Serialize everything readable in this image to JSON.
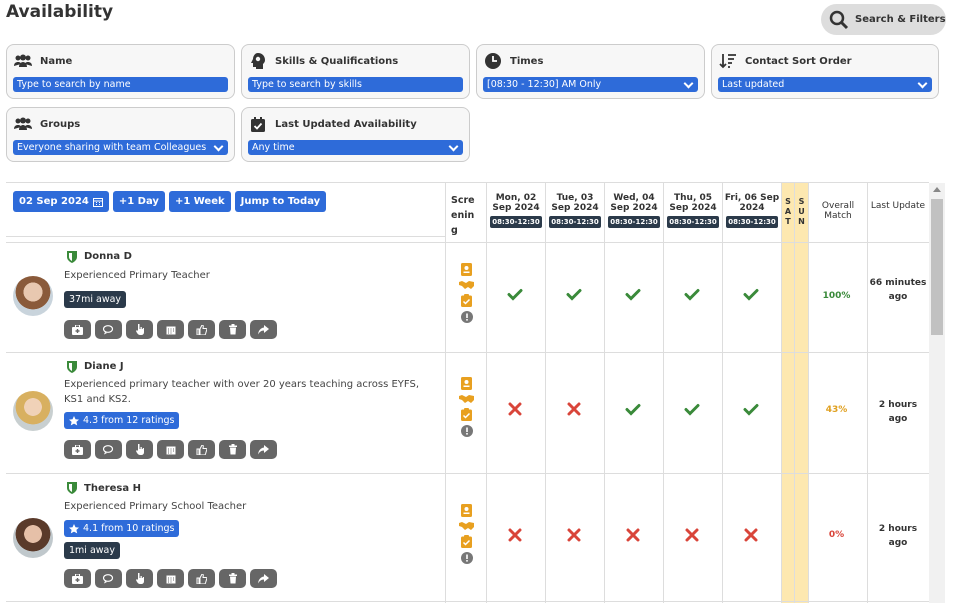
{
  "page_title": "Availability",
  "search_filters_label": "Search & Filters",
  "filters": {
    "name": {
      "label": "Name",
      "placeholder": "Type to search by name"
    },
    "skills": {
      "label": "Skills & Qualifications",
      "placeholder": "Type to search by skills"
    },
    "times": {
      "label": "Times",
      "value": "[08:30 - 12:30] AM Only"
    },
    "sort": {
      "label": "Contact Sort Order",
      "value": "Last updated"
    },
    "groups": {
      "label": "Groups",
      "value": "Everyone sharing with team Colleagues"
    },
    "last_updated": {
      "label": "Last Updated Availability",
      "value": "Any time"
    }
  },
  "toolbar": {
    "date": "02 Sep 2024",
    "plus_day": "+1 Day",
    "plus_week": "+1 Week",
    "jump_today": "Jump to Today"
  },
  "columns": {
    "screening": "Scre enin g",
    "days": [
      {
        "line1": "Mon, 02",
        "line2": "Sep 2024",
        "time": "08:30-12:30"
      },
      {
        "line1": "Tue, 03",
        "line2": "Sep 2024",
        "time": "08:30-12:30"
      },
      {
        "line1": "Wed, 04",
        "line2": "Sep 2024",
        "time": "08:30-12:30"
      },
      {
        "line1": "Thu, 05",
        "line2": "Sep 2024",
        "time": "08:30-12:30"
      },
      {
        "line1": "Fri, 06 Sep",
        "line2": "2024",
        "time": "08:30-12:30"
      }
    ],
    "sat": "S A T",
    "sun": "S U N",
    "overall": "Overall Match",
    "last_update": "Last Update"
  },
  "rows": [
    {
      "name": "Donna D",
      "desc": "Experienced Primary Teacher",
      "badge": "37mi away",
      "days": [
        "check",
        "check",
        "check",
        "check",
        "check"
      ],
      "match": "100%",
      "match_color": "#3a8a3a",
      "update": "66 minutes ago"
    },
    {
      "name": "Diane J",
      "desc": "Experienced primary teacher with over 20 years teaching across EYFS, KS1 and KS2.",
      "rating": "4.3 from 12 ratings",
      "days": [
        "cross",
        "cross",
        "check",
        "check",
        "check"
      ],
      "match": "43%",
      "match_color": "#e0a020",
      "update": "2 hours ago"
    },
    {
      "name": "Theresa H",
      "desc": "Experienced Primary School Teacher",
      "rating": "4.1 from 10 ratings",
      "badge": "1mi away",
      "days": [
        "cross",
        "cross",
        "cross",
        "cross",
        "cross"
      ],
      "match": "0%",
      "match_color": "#d9453a",
      "update": "2 hours ago"
    }
  ],
  "colors": {
    "accent": "#2e6bd9",
    "check": "#3a8a3a",
    "cross": "#d9453a",
    "weekend": "#fde8b0",
    "screening": "#e8a020"
  }
}
